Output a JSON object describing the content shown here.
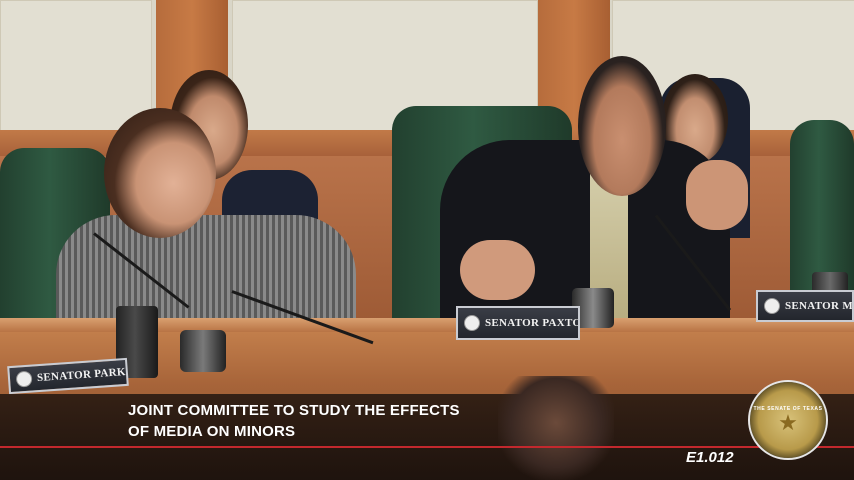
{
  "broadcast": {
    "headline_line1": "JOINT COMMITTEE TO STUDY THE EFFECTS",
    "headline_line2": "OF MEDIA ON MINORS",
    "program_code": "E1.012",
    "seal_label": "THE SENATE OF TEXAS"
  },
  "nameplates": {
    "left": "SENATOR PARKER",
    "center": "SENATOR PAXTON",
    "right": "SENATOR MENEN"
  },
  "colors": {
    "accent_line": "#c3282d",
    "chair_green": "#2f5a42",
    "wood": "#b9734a"
  }
}
